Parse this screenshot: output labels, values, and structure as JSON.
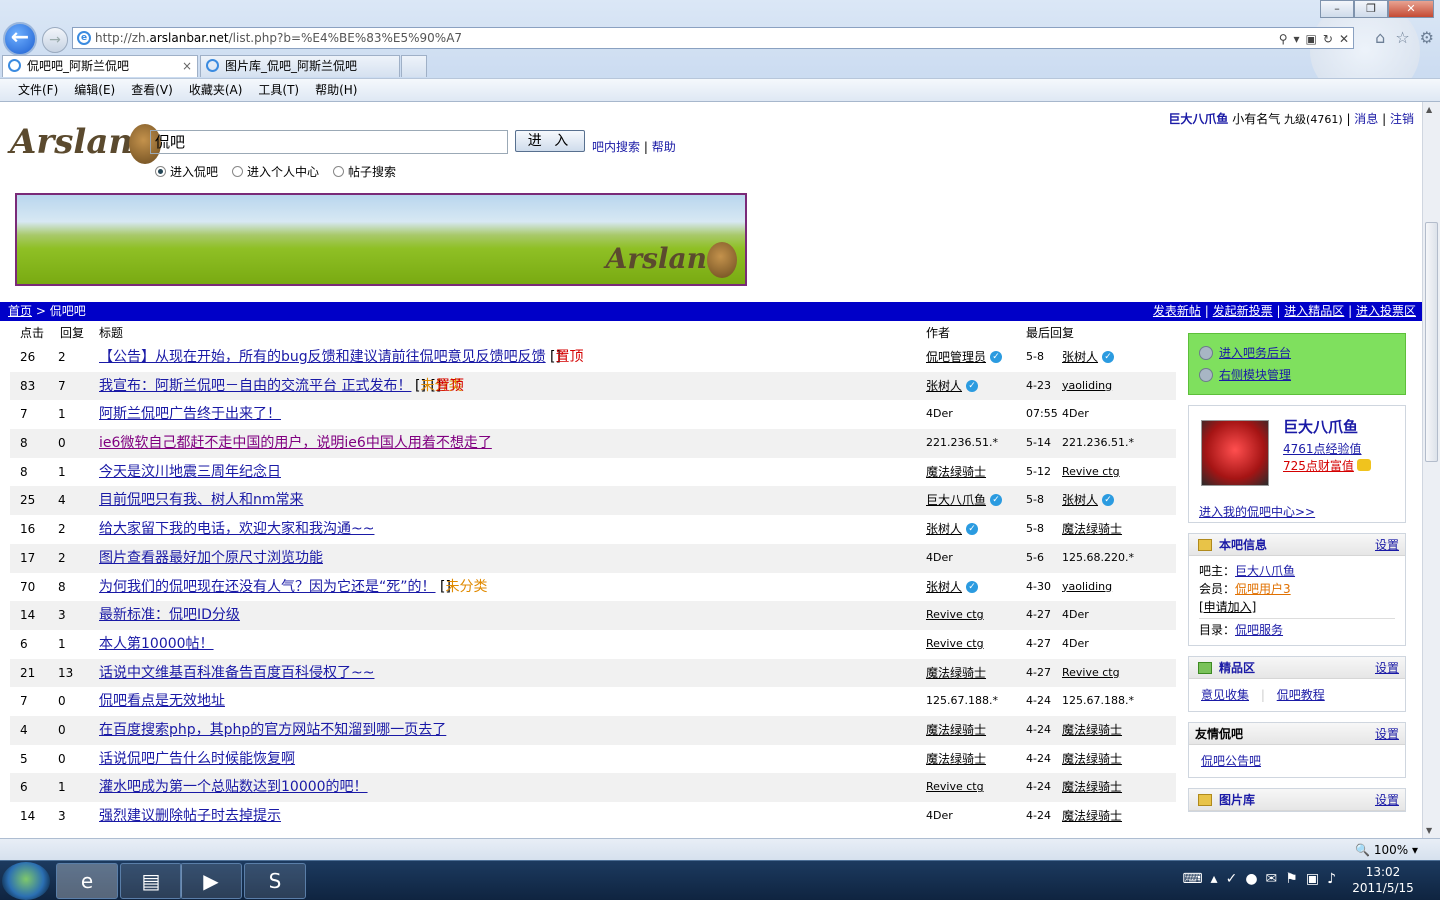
{
  "browser": {
    "url_prefix": "http://zh.",
    "url_domain": "arslanbar.net",
    "url_rest": "/list.php?b=%E4%BE%83%E5%90%A7",
    "tabs": [
      {
        "label": "侃吧吧_阿斯兰侃吧"
      },
      {
        "label": "图片库_侃吧_阿斯兰侃吧"
      }
    ],
    "menu": [
      "文件(F)",
      "编辑(E)",
      "查看(V)",
      "收藏夹(A)",
      "工具(T)",
      "帮助(H)"
    ],
    "zoom": "100%"
  },
  "userbar": {
    "username": "巨大八爪鱼",
    "title": "小有名气",
    "level": "九级(4761)",
    "messages": "消息",
    "logout": "注销"
  },
  "logo_text": "Arslan",
  "search": {
    "value": "侃吧",
    "button": "进 入",
    "link_in_bar": "吧内搜索",
    "link_help": "帮助",
    "radios": [
      "进入侃吧",
      "进入个人中心",
      "帖子搜索"
    ]
  },
  "breadcrumb": {
    "home": "首页",
    "sep": ">",
    "current": "侃吧吧"
  },
  "actions": [
    "发表新帖",
    "发起新投票",
    "进入精品区",
    "进入投票区"
  ],
  "table": {
    "headers": {
      "click": "点击",
      "reply": "回复",
      "title": "标题",
      "author": "作者",
      "last": "最后回复"
    },
    "rows": [
      {
        "click": "26",
        "reply": "2",
        "title": "【公告】从现在开始，所有的bug反馈和建议请前往侃吧意见反馈吧反馈",
        "tag1": "置顶",
        "tag2": "",
        "author": "侃吧管理员",
        "date": "5-8",
        "last": "张树人"
      },
      {
        "click": "83",
        "reply": "7",
        "title": "我宣布：阿斯兰侃吧－自由的交流平台 正式发布！",
        "tag1": "置顶",
        "tag2": "未分类",
        "author": "张树人",
        "date": "4-23",
        "last": "yaoliding"
      },
      {
        "click": "7",
        "reply": "1",
        "title": "阿斯兰侃吧广告终于出来了！",
        "tag1": "",
        "tag2": "",
        "author": "4Der",
        "date": "07:55",
        "last": "4Der"
      },
      {
        "click": "8",
        "reply": "0",
        "title": "ie6微软自己都赶不走中国的用户，说明ie6中国人用着不想走了",
        "tag1": "",
        "tag2": "",
        "author": "221.236.51.*",
        "date": "5-14",
        "last": "221.236.51.*"
      },
      {
        "click": "8",
        "reply": "1",
        "title": "今天是汶川地震三周年纪念日",
        "tag1": "",
        "tag2": "",
        "author": "魔法绿骑士",
        "date": "5-12",
        "last": "Revive ctg"
      },
      {
        "click": "25",
        "reply": "4",
        "title": "目前侃吧只有我、树人和nm常来",
        "tag1": "",
        "tag2": "",
        "author": "巨大八爪鱼",
        "date": "5-8",
        "last": "张树人"
      },
      {
        "click": "16",
        "reply": "2",
        "title": "给大家留下我的电话，欢迎大家和我沟通~~",
        "tag1": "",
        "tag2": "",
        "author": "张树人",
        "date": "5-8",
        "last": "魔法绿骑士"
      },
      {
        "click": "17",
        "reply": "2",
        "title": "图片查看器最好加个原尺寸浏览功能",
        "tag1": "",
        "tag2": "",
        "author": "4Der",
        "date": "5-6",
        "last": "125.68.220.*"
      },
      {
        "click": "70",
        "reply": "8",
        "title": "为何我们的侃吧现在还没有人气？因为它还是“死”的！",
        "tag1": "",
        "tag2": "未分类",
        "author": "张树人",
        "date": "4-30",
        "last": "yaoliding"
      },
      {
        "click": "14",
        "reply": "3",
        "title": "最新标准：侃吧ID分级",
        "tag1": "",
        "tag2": "",
        "author": "Revive ctg",
        "date": "4-27",
        "last": "4Der"
      },
      {
        "click": "6",
        "reply": "1",
        "title": "本人第10000帖！",
        "tag1": "",
        "tag2": "",
        "author": "Revive ctg",
        "date": "4-27",
        "last": "4Der"
      },
      {
        "click": "21",
        "reply": "13",
        "title": "话说中文维基百科准备告百度百科侵权了~~",
        "tag1": "",
        "tag2": "",
        "author": "魔法绿骑士",
        "date": "4-27",
        "last": "Revive ctg"
      },
      {
        "click": "7",
        "reply": "0",
        "title": "侃吧看点是无效地址",
        "tag1": "",
        "tag2": "",
        "author": "125.67.188.*",
        "date": "4-24",
        "last": "125.67.188.*"
      },
      {
        "click": "4",
        "reply": "0",
        "title": "在百度搜索php，其php的官方网站不知溜到哪一页去了",
        "tag1": "",
        "tag2": "",
        "author": "魔法绿骑士",
        "date": "4-24",
        "last": "魔法绿骑士"
      },
      {
        "click": "5",
        "reply": "0",
        "title": "话说侃吧广告什么时候能恢复啊",
        "tag1": "",
        "tag2": "",
        "author": "魔法绿骑士",
        "date": "4-24",
        "last": "魔法绿骑士"
      },
      {
        "click": "6",
        "reply": "1",
        "title": "灌水吧成为第一个总贴数达到10000的吧！",
        "tag1": "",
        "tag2": "",
        "author": "Revive ctg",
        "date": "4-24",
        "last": "魔法绿骑士"
      },
      {
        "click": "14",
        "reply": "3",
        "title": "强烈建议删除帖子时去掉提示",
        "tag1": "",
        "tag2": "",
        "author": "4Der",
        "date": "4-24",
        "last": "魔法绿骑士"
      }
    ]
  },
  "sidebar": {
    "admin": {
      "backend": "进入吧务后台",
      "manage": "右侧模块管理"
    },
    "user": {
      "name": "巨大八爪鱼",
      "exp": "4761点经验值",
      "rich": "725点财富值",
      "center": "进入我的侃吧中心>>"
    },
    "bar_info": {
      "title": "本吧信息",
      "set": "设置",
      "owner_label": "吧主：",
      "owner": "巨大八爪鱼",
      "member_label": "会员：",
      "member": "侃吧用户3",
      "apply": "[申请加入]",
      "dir_label": "目录：",
      "dir": "侃吧服务"
    },
    "elite": {
      "title": "精品区",
      "set": "设置",
      "links": [
        "意见收集",
        "侃吧教程"
      ]
    },
    "friends": {
      "title": "友情侃吧",
      "set": "设置",
      "links": [
        "侃吧公告吧"
      ]
    },
    "gallery": {
      "title": "图片库",
      "set": "设置"
    }
  },
  "taskbar": {
    "time": "13:02",
    "date": "2011/5/15"
  }
}
